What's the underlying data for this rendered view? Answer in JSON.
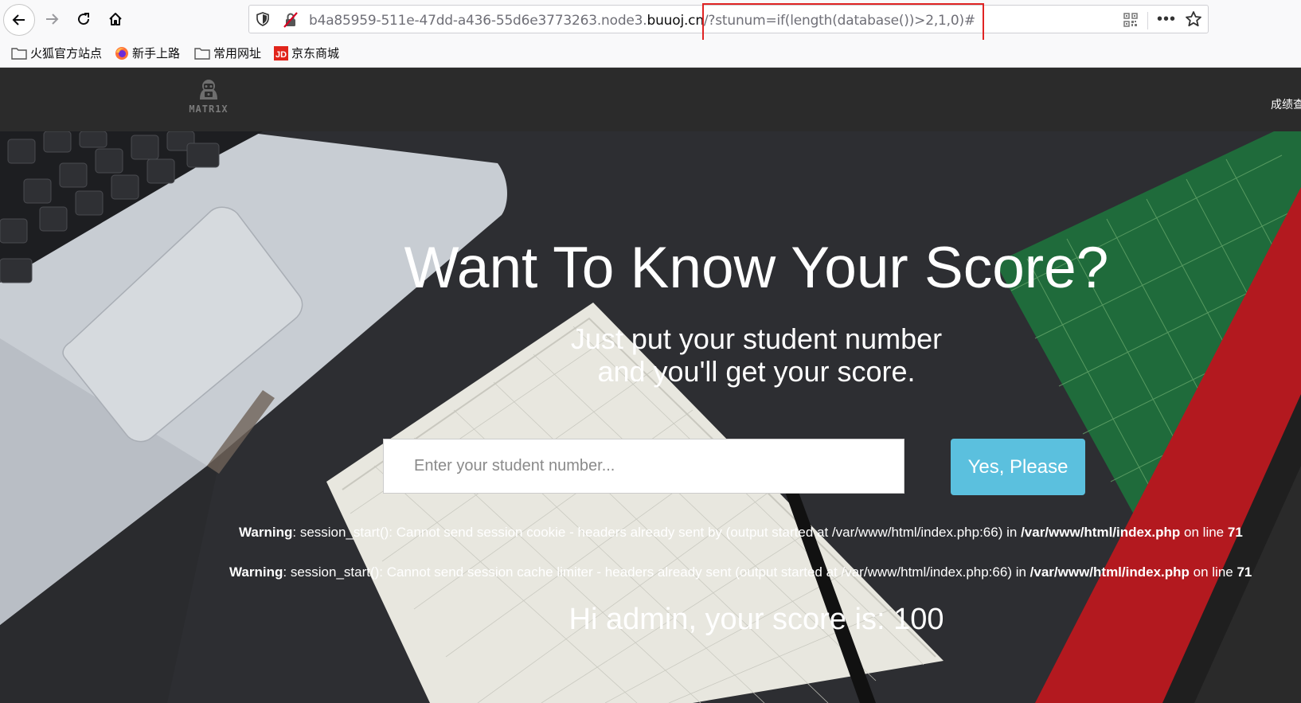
{
  "browser": {
    "url_host_prefix": "b4a85959-511e-47dd-a436-55d6e3773263.node3.",
    "url_domain": "buuoj.cn",
    "url_path": "/?stunum=if(length(database())>2,1,0)#",
    "bookmarks": [
      "火狐官方站点",
      "新手上路",
      "常用网址",
      "京东商城"
    ]
  },
  "site": {
    "logo_text": "MATR1X",
    "nav_link": "成绩查"
  },
  "hero": {
    "headline": "Want To Know Your Score?",
    "sub_line1": "Just put your student number",
    "sub_line2": "and you'll get your score.",
    "input_placeholder": "Enter your student number...",
    "button_label": "Yes, Please"
  },
  "warnings": [
    {
      "label": "Warning",
      "message": ": session_start(): Cannot send session cookie - headers already sent by (output started at /var/www/html/index.php:66) in ",
      "file": "/var/www/html/index.php",
      "line_text": " on line ",
      "line": "71"
    },
    {
      "label": "Warning",
      "message": ": session_start(): Cannot send session cache limiter - headers already sent (output started at /var/www/html/index.php:66) in ",
      "file": "/var/www/html/index.php",
      "line_text": " on line ",
      "line": "71"
    }
  ],
  "result": "Hi admin, your score is: 100",
  "colors": {
    "nav_bg": "#2b2b2b",
    "button_bg": "#5bc0de",
    "highlight_box": "#e02424"
  }
}
